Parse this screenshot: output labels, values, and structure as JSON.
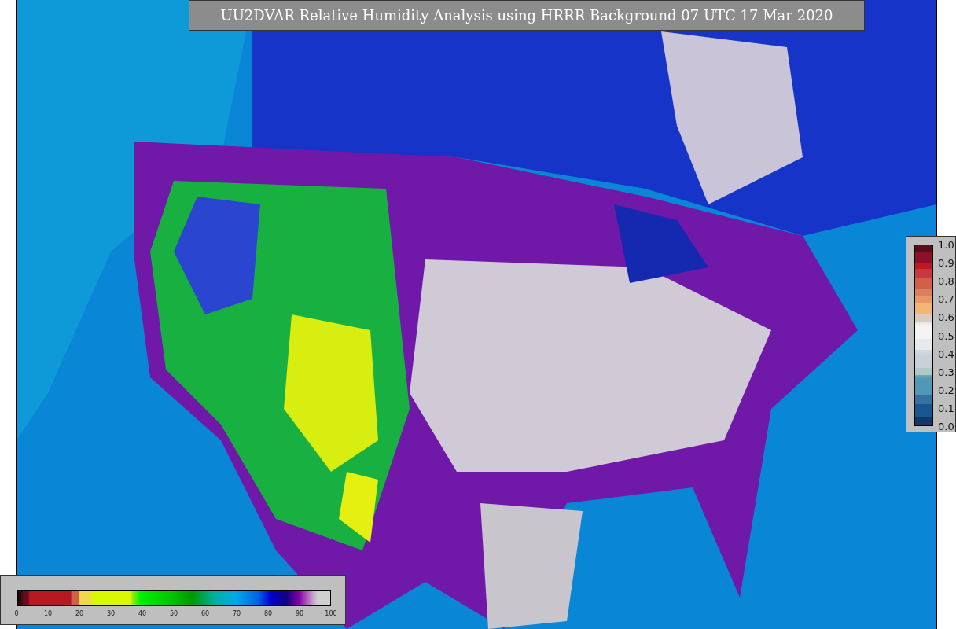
{
  "title": "UU2DVAR Relative Humidity Analysis using HRRR Background 07 UTC 17 Mar 2020",
  "humidity_colorbar": {
    "ticks": [
      "0",
      "10",
      "20",
      "30",
      "40",
      "50",
      "60",
      "70",
      "80",
      "90",
      "100"
    ]
  },
  "increment_colorbar": {
    "ticks": [
      "1.0",
      "0.9",
      "0.8",
      "0.7",
      "0.6",
      "0.5",
      "0.4",
      "0.3",
      "0.2",
      "0.1",
      "0.0"
    ]
  }
}
